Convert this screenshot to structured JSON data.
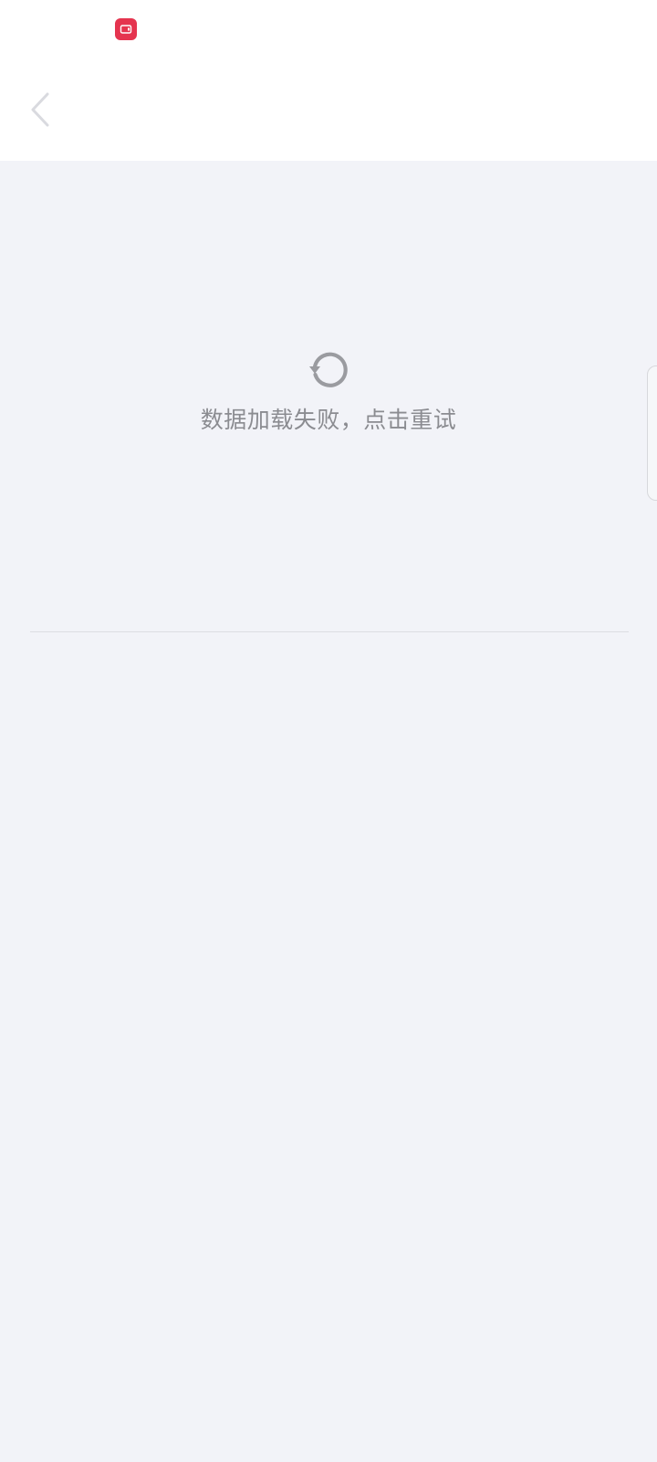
{
  "status_bar": {
    "recording_icon": "screen-record-icon",
    "recording_color": "#e5344f"
  },
  "toolbar": {
    "back_icon": "chevron-left-icon",
    "title": ""
  },
  "error_state": {
    "icon": "refresh-icon",
    "message": "数据加载失败，点击重试"
  },
  "colors": {
    "background": "#f2f3f8",
    "toolbar": "#ffffff",
    "muted_text": "#8b8c91",
    "icon_gray": "#9a9ba0"
  }
}
